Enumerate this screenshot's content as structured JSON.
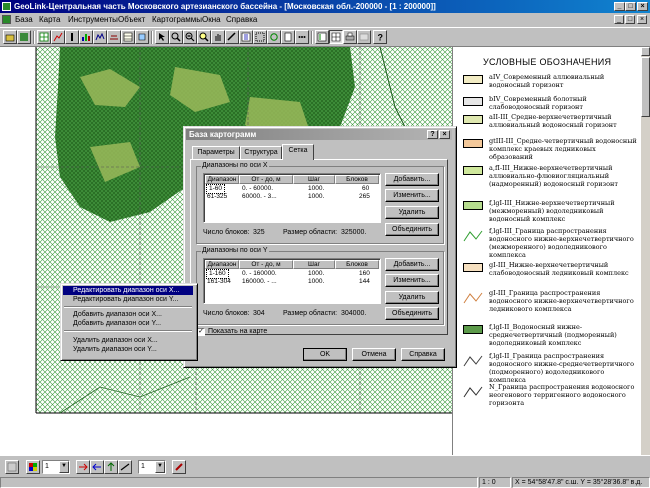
{
  "window": {
    "title": "GeoLink-Центральная часть Московского артезианского бассейна - [Московская обл.-200000 - [1 : 200000]]",
    "minimize": "_",
    "maximize": "□",
    "close": "×"
  },
  "menu": {
    "items": [
      "База",
      "Карта",
      "Инструменты",
      "Объект",
      "Картограммы",
      "Окна",
      "Справка"
    ]
  },
  "legend": {
    "title": "УСЛОВНЫЕ ОБОЗНАЧЕНИЯ",
    "items": [
      {
        "text": "aIV_Современный аллювиальный водоносный горизонт",
        "color": "#f2ecc4",
        "style": "fill"
      },
      {
        "text": "bIV_Современный болотный слабоводоносный горизонт",
        "color": "#e6e6e6",
        "style": "fill"
      },
      {
        "text": "aII-III_Средне-верхнечетвертичный аллювиальный водоносный горизонт",
        "color": "#dfe8b0",
        "style": "fill"
      },
      {
        "text": "gtIII-III_Средне-четвертичный водоносный комплекс краевых ледниковых образований",
        "color": "#f3c89a",
        "style": "fill"
      },
      {
        "text": "a,fI-III_Нижне-верхнечетвертичный аллювиально-флювиогляциальный (надморенный) водоносный горизонт",
        "color": "#cfe89c",
        "style": "fill"
      },
      {
        "text": "f,lgI-III_Нижне-верхнечетвертичный (межморенный) водоледниковый водоносный комплекс",
        "color": "#b6dc8e",
        "style": "fill"
      },
      {
        "text": "f,lgI-III_Граница распространения водоносного нижне-верхнечетвертичного (межморенного) водоледникового комплекса",
        "color": "#2f9e2f",
        "style": "line"
      },
      {
        "text": "gI-III_Нижне-верхнечетвертичный слабоводоносный ледниковый комплекс",
        "color": "#f6e0c0",
        "style": "fill"
      },
      {
        "text": "gI-III_Граница распространения водоносного нижне-верхнечетвертичного ледникового комплекса",
        "color": "#d08040",
        "style": "line"
      },
      {
        "text": "f,lgI-II_Водоносный нижне-среднечетвертичный (подморенный) водоледниковый комплекс",
        "color": "#5c9a4a",
        "style": "fill"
      },
      {
        "text": "f,lgI-II_Граница распространения водоносного нижне-среднечетвертичного (подморенного) водоледникового комплекса",
        "color": "#404040",
        "style": "line"
      },
      {
        "text": "N_Граница распространения водоносного неогенового терригенного водоносного горизонта",
        "color": "#303030",
        "style": "line"
      }
    ]
  },
  "dialog": {
    "title": "База картограмм",
    "help_btn": "?",
    "close_btn": "×",
    "tabs": [
      "Параметры",
      "Структура",
      "Сетка"
    ],
    "active_tab": 2,
    "x_group": {
      "label": "Диапазоны по оси X",
      "columns": [
        "Диапазон",
        "От - до, м",
        "Шаг",
        "Блоков"
      ],
      "rows": [
        [
          "1-60",
          "0. - 60000.",
          "1000.",
          "60"
        ],
        [
          "61-325",
          "60000. - 3...",
          "1000.",
          "265"
        ]
      ],
      "buttons": [
        "Добавить...",
        "Изменить...",
        "Удалить",
        "Объединить"
      ],
      "blocks_label": "Число блоков:",
      "blocks_value": "325",
      "size_label": "Размер области:",
      "size_value": "325000."
    },
    "y_group": {
      "label": "Диапазоны по оси Y",
      "columns": [
        "Диапазон",
        "От - до, м",
        "Шаг",
        "Блоков"
      ],
      "rows": [
        [
          "1-160",
          "0. - 160000.",
          "1000.",
          "160"
        ],
        [
          "161-304",
          "160000. - ...",
          "1000.",
          "144"
        ]
      ],
      "buttons": [
        "Добавить...",
        "Изменить...",
        "Удалить",
        "Объединить"
      ],
      "blocks_label": "Число блоков:",
      "blocks_value": "304",
      "size_label": "Размер области:",
      "size_value": "304000."
    },
    "show_on_map": "Показать на карте",
    "show_on_map_checked": true,
    "ok": "OK",
    "cancel": "Отмена",
    "help": "Справка"
  },
  "context_menu": {
    "items": [
      "Редактировать диапазон оси X...",
      "Редактировать диапазон оси Y...",
      "Добавить диапазон оси X...",
      "Добавить диапазон оси Y...",
      "Удалить диапазон оси X...",
      "Удалить диапазон оси Y..."
    ],
    "selected_index": 0
  },
  "bottom_toolbar": {
    "combo1_value": "1",
    "combo2_value": "1"
  },
  "status": {
    "scale": "1 : 0",
    "coords": "X = 54°58'47.8\" с.ш.  Y = 35°28'36.8\" в.д."
  }
}
